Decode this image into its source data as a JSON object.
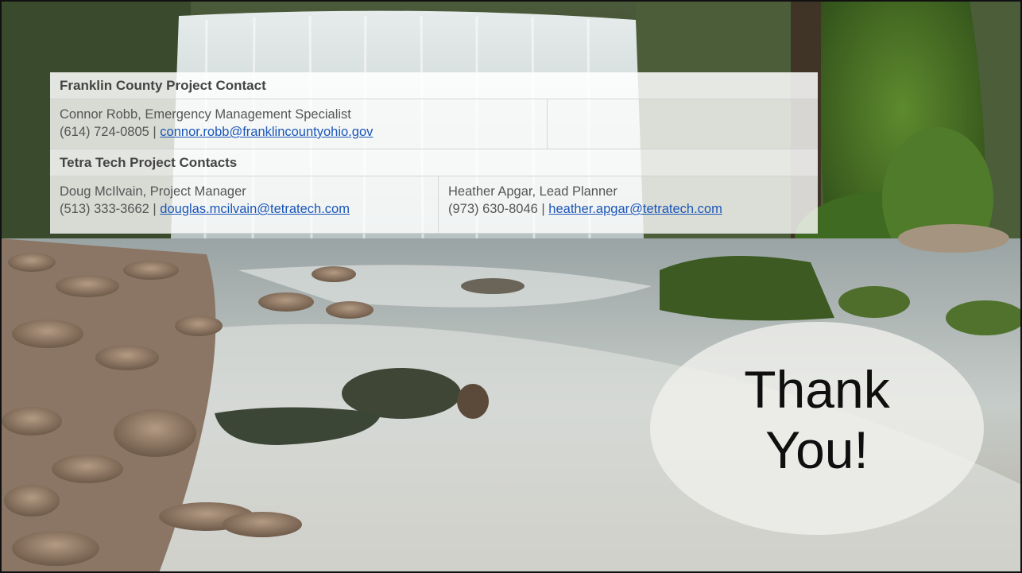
{
  "header_county": "Franklin County Project Contact",
  "county_contact": {
    "name_title": "Connor Robb, Emergency Management Specialist",
    "phone": "(614) 724-0805 | ",
    "email": "connor.robb@franklincountyohio.gov"
  },
  "header_tetra": "Tetra Tech Project Contacts",
  "tetra_contacts": [
    {
      "name_title": "Doug McIlvain, Project Manager",
      "phone": "(513) 333-3662 | ",
      "email": "douglas.mcilvain@tetratech.com"
    },
    {
      "name_title": "Heather Apgar, Lead Planner",
      "phone": "(973) 630-8046 | ",
      "email": "heather.apgar@tetratech.com"
    }
  ],
  "thank_you": {
    "line1": "Thank",
    "line2": "You!"
  },
  "colors": {
    "link": "#1a56b8",
    "header_text": "#444444",
    "body_text": "#555555"
  }
}
